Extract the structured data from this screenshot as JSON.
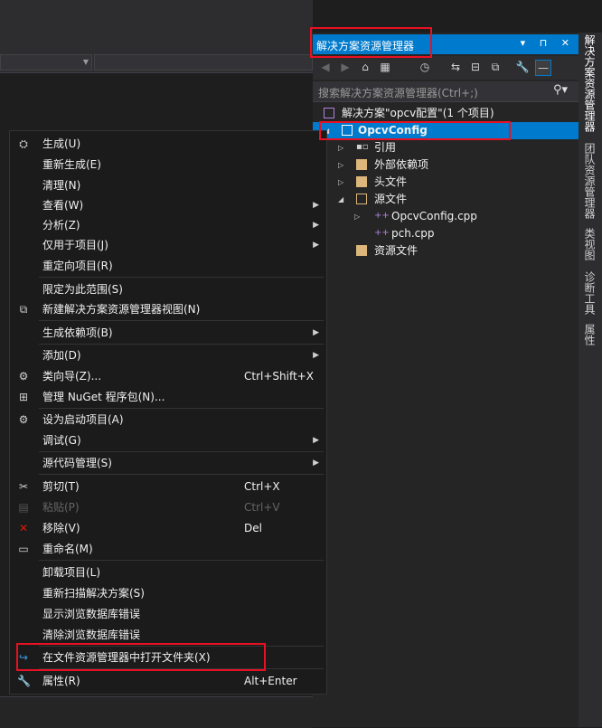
{
  "solution_explorer": {
    "title": "解决方案资源管理器",
    "title_buttons": "▾ ⊓ ✕",
    "search_placeholder": "搜索解决方案资源管理器(Ctrl+;)",
    "tree": {
      "solution": "解决方案\"opcv配置\"(1 个项目)",
      "project": "OpcvConfig",
      "references": "引用",
      "external_deps": "外部依赖项",
      "header_files": "头文件",
      "source_files": "源文件",
      "file_opcvconfig": "OpcvConfig.cpp",
      "file_pch": "pch.cpp",
      "resource_files": "资源文件"
    }
  },
  "side_tabs": [
    "解决方案资源管理器",
    "团队资源管理器",
    "类视图",
    "诊断工具",
    "属性"
  ],
  "context_menu": {
    "build": "生成(U)",
    "rebuild": "重新生成(E)",
    "clean": "清理(N)",
    "view": "查看(W)",
    "analyze": "分析(Z)",
    "project_only": "仅用于项目(J)",
    "retarget": "重定向项目(R)",
    "scope_to_this": "限定为此范围(S)",
    "new_se_view": "新建解决方案资源管理器视图(N)",
    "build_deps": "生成依赖项(B)",
    "add": "添加(D)",
    "class_wizard": "类向导(Z)...",
    "class_wizard_shortcut": "Ctrl+Shift+X",
    "manage_nuget": "管理 NuGet 程序包(N)...",
    "set_startup": "设为启动项目(A)",
    "debug": "调试(G)",
    "source_control": "源代码管理(S)",
    "cut": "剪切(T)",
    "cut_shortcut": "Ctrl+X",
    "paste": "粘贴(P)",
    "paste_shortcut": "Ctrl+V",
    "remove": "移除(V)",
    "remove_shortcut": "Del",
    "rename": "重命名(M)",
    "unload": "卸载项目(L)",
    "rescan": "重新扫描解决方案(S)",
    "show_db_errors": "显示浏览数据库错误",
    "clear_db_errors": "清除浏览数据库错误",
    "open_in_explorer": "在文件资源管理器中打开文件夹(X)",
    "properties": "属性(R)",
    "properties_shortcut": "Alt+Enter"
  },
  "colors": {
    "accent": "#007acc",
    "annotation": "#e81123",
    "menu_bg": "#1b1b1c"
  }
}
